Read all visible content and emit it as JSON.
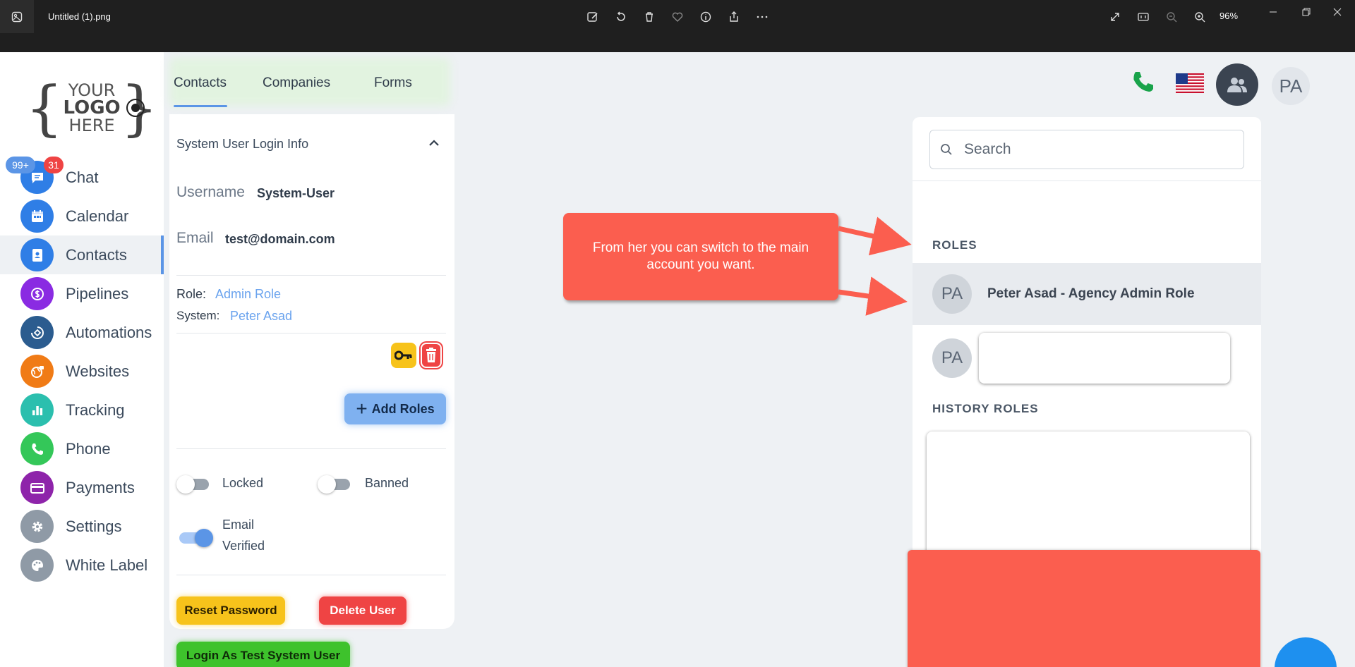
{
  "viewer": {
    "file_title": "Untitled (1).png",
    "zoom": "96%"
  },
  "sidebar": {
    "logo": {
      "line1": "YOUR",
      "line2": "LOGO",
      "line3": "HERE"
    },
    "badges": {
      "messages": "99+",
      "notifications": "31"
    },
    "items": [
      {
        "label": "Chat",
        "icon": "chat-icon",
        "color": "#2f7ee6"
      },
      {
        "label": "Calendar",
        "icon": "calendar-icon",
        "color": "#2f7ee6"
      },
      {
        "label": "Contacts",
        "icon": "contacts-icon",
        "color": "#2f7ee6"
      },
      {
        "label": "Pipelines",
        "icon": "dollar-icon",
        "color": "#8a2be2"
      },
      {
        "label": "Automations",
        "icon": "automation-icon",
        "color": "#2b5c8f"
      },
      {
        "label": "Websites",
        "icon": "globe-icon",
        "color": "#f07b16"
      },
      {
        "label": "Tracking",
        "icon": "bar-chart-icon",
        "color": "#2bbfae"
      },
      {
        "label": "Phone",
        "icon": "phone-icon",
        "color": "#34c759"
      },
      {
        "label": "Payments",
        "icon": "card-icon",
        "color": "#8e24aa"
      },
      {
        "label": "Settings",
        "icon": "gear-icon",
        "color": "#8f9aa6"
      },
      {
        "label": "White Label",
        "icon": "palette-icon",
        "color": "#8f9aa6"
      }
    ]
  },
  "tabs": [
    "Contacts",
    "Companies",
    "Forms"
  ],
  "panel": {
    "title": "System User Login Info",
    "username_label": "Username",
    "username": "System-User",
    "email_label": "Email",
    "email": "test@domain.com",
    "role_label": "Role:",
    "role": "Admin Role",
    "system_label": "System:",
    "system": "Peter Asad",
    "add_roles": "Add Roles",
    "locked": "Locked",
    "banned": "Banned",
    "email_verified_1": "Email",
    "email_verified_2": "Verified",
    "reset_password": "Reset Password",
    "delete_user": "Delete User",
    "login_as": "Login As Test System User"
  },
  "header": {
    "avatar_initials": "PA"
  },
  "dropdown": {
    "search_placeholder": "Search",
    "roles_heading": "ROLES",
    "roles": [
      {
        "initials": "PA",
        "name": "Peter Asad - Agency Admin Role"
      },
      {
        "initials": "PA",
        "name": ""
      }
    ],
    "history_heading": "HISTORY ROLES"
  },
  "callout": {
    "text": "From her you can switch to the main account you want."
  },
  "colors": {
    "accent": "#5b95e6",
    "callout": "#fb5e4f",
    "yellow": "#f7c31b",
    "red": "#ef4444",
    "green": "#3ec22c"
  }
}
